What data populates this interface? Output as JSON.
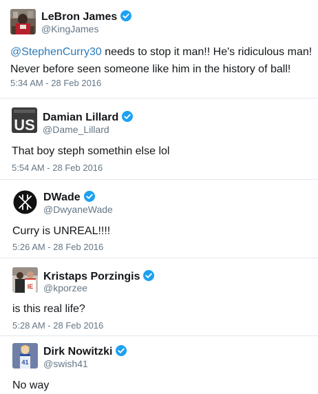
{
  "tweets": [
    {
      "name": "LeBron James",
      "handle": "@KingJames",
      "mention": "@StephenCurry30",
      "text_line1": " needs to stop it man!! He's ridiculous man!",
      "text_line2": "Never before seen someone like him in the history of ball!",
      "time": "5:34 AM - 28 Feb 2016",
      "avatar": "lebron-photo"
    },
    {
      "name": "Damian Lillard",
      "handle": "@Dame_Lillard",
      "text": "That boy steph somethin else lol",
      "time": "5:54 AM - 28 Feb 2016",
      "avatar": "us-logo",
      "avatar_label": "US"
    },
    {
      "name": "DWade",
      "handle": "@DwyaneWade",
      "text": "Curry is UNREAL!!!!",
      "time": "5:26 AM - 28 Feb 2016",
      "avatar": "way-of-wade-logo"
    },
    {
      "name": "Kristaps Porzingis",
      "handle": "@kporzee",
      "text": "is this real life?",
      "time": "5:28 AM - 28 Feb 2016",
      "avatar": "porzingis-photo"
    },
    {
      "name": "Dirk Nowitzki",
      "handle": "@swish41",
      "text": "No way",
      "avatar": "dirk-cartoon"
    }
  ],
  "colors": {
    "verified": "#1da1f2",
    "link": "#2b7bb9",
    "meta": "#657786",
    "text": "#14171a"
  },
  "icons": {
    "verified": "verified-badge-icon"
  }
}
